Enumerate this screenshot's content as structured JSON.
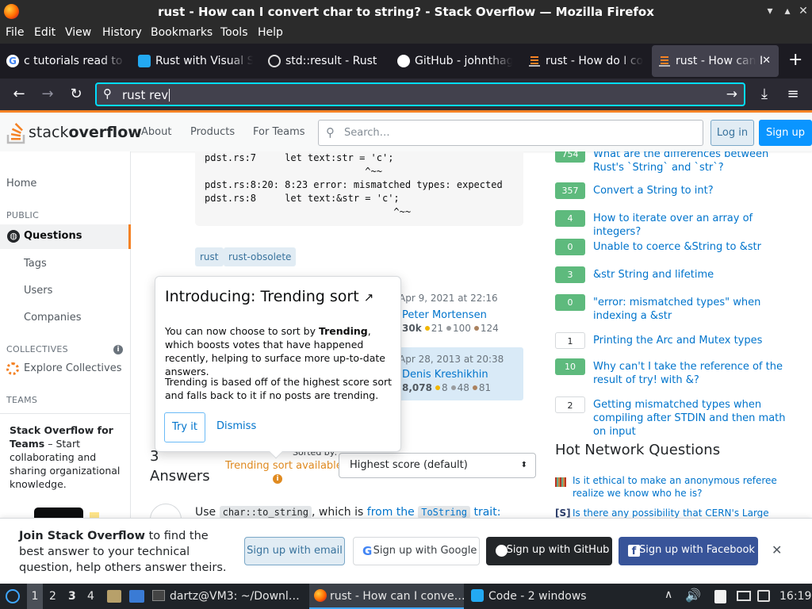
{
  "window": {
    "title": "rust - How can I convert char to string? - Stack Overflow — Mozilla Firefox"
  },
  "menubar": [
    "File",
    "Edit",
    "View",
    "History",
    "Bookmarks",
    "Tools",
    "Help"
  ],
  "tabs": [
    {
      "label": "c tutorials read to",
      "icon": "google-icon"
    },
    {
      "label": "Rust with Visual S",
      "icon": "vscode-icon"
    },
    {
      "label": "std::result - Rust",
      "icon": "rust-icon"
    },
    {
      "label": "GitHub - johnthag",
      "icon": "github-icon"
    },
    {
      "label": "rust - How do I co",
      "icon": "stackoverflow-icon"
    },
    {
      "label": "rust - How can I",
      "icon": "stackoverflow-icon",
      "active": true
    }
  ],
  "urlbar": {
    "value": "rust rev"
  },
  "so": {
    "logo_a": "stack",
    "logo_b": "overflow",
    "nav": [
      "About",
      "Products",
      "For Teams"
    ],
    "search_placeholder": "Search…",
    "login": "Log in",
    "signup": "Sign up"
  },
  "leftnav": {
    "home": "Home",
    "public": "PUBLIC",
    "questions": "Questions",
    "tags": "Tags",
    "users": "Users",
    "companies": "Companies",
    "collectives": "COLLECTIVES",
    "explore": "Explore Collectives",
    "teams": "TEAMS",
    "teams_title": "Stack Overflow for Teams",
    "teams_text": " – Start collaborating and sharing organizational knowledge."
  },
  "main": {
    "code_lines": [
      "pdst.rs:7     let text:str = 'c';",
      "                            ^~~",
      "pdst.rs:8:20: 8:23 error: mismatched types: expected",
      "pdst.rs:8     let text:&str = 'c';",
      "                                 ^~~"
    ],
    "tags": [
      "rust",
      "rust-obsolete"
    ],
    "edited": {
      "date": "Apr 9, 2021 at 22:16",
      "user": "Peter Mortensen",
      "rep": "30k",
      "gold": "21",
      "silver": "100",
      "bronze": "124"
    },
    "asked": {
      "date": "Apr 28, 2013 at 20:38",
      "user": "Denis Kreshikhin",
      "rep": "8,078",
      "gold": "8",
      "silver": "48",
      "bronze": "81"
    },
    "answers_count": "3",
    "answers_label": "Answers",
    "sorted_by": "Sorted by:",
    "trending_available": "Trending sort available",
    "sort_value": "Highest score (default)",
    "answer_start": "Use",
    "answer_code1": "char::to_string",
    "answer_mid": ", which is",
    "answer_link": "from the",
    "answer_code2": "ToString",
    "answer_end": "trait:"
  },
  "popup": {
    "title": "Introducing: Trending sort",
    "p1_a": "You can now choose to sort by ",
    "p1_b": "Trending",
    "p1_c": ", which boosts votes that have happened recently, helping to surface more up-to-date answers.",
    "p2": "Trending is based off of the highest score sort and falls back to it if no posts are trending.",
    "try": "Try it",
    "dismiss": "Dismiss"
  },
  "related": [
    {
      "score": "754",
      "text": "What are the differences between Rust's `String` and `str`?",
      "accepted": true
    },
    {
      "score": "357",
      "text": "Convert a String to int?",
      "accepted": true
    },
    {
      "score": "4",
      "text": "How to iterate over an array of integers?",
      "accepted": true
    },
    {
      "score": "0",
      "text": "Unable to coerce &String to &str",
      "accepted": true
    },
    {
      "score": "3",
      "text": "&str String and lifetime",
      "accepted": true
    },
    {
      "score": "0",
      "text": "\"error: mismatched types\" when indexing a &str",
      "accepted": true
    },
    {
      "score": "1",
      "text": "Printing the Arc and Mutex types",
      "accepted": false
    },
    {
      "score": "10",
      "text": "Why can't I take the reference of the result of try! with &?",
      "accepted": true
    },
    {
      "score": "2",
      "text": "Getting mismatched types when compiling after STDIN and then math on input",
      "accepted": false
    }
  ],
  "hnq": {
    "title": "Hot Network Questions",
    "items": [
      "Is it ethical to make an anonymous referee realize we know who he is?",
      "Is there any possibility that CERN's Large Hadron"
    ]
  },
  "banner": {
    "bold": "Join Stack Overflow",
    "rest": " to find the best answer to your technical question, help others answer theirs.",
    "email": "Sign up with email",
    "google": "Sign up with Google",
    "github": "Sign up with GitHub",
    "facebook": "Sign up with Facebook"
  },
  "taskbar": {
    "workspaces": [
      "1",
      "2",
      "3",
      "4"
    ],
    "terminal": "dartz@VM3: ~/Downl…",
    "firefox": "rust - How can I conve…",
    "code": "Code - 2 windows",
    "clock": "16:19"
  },
  "colors": {
    "accent": "#f48225",
    "link": "#0074cc",
    "accepted": "#5eba7d",
    "urlfocus": "#00ddff"
  }
}
